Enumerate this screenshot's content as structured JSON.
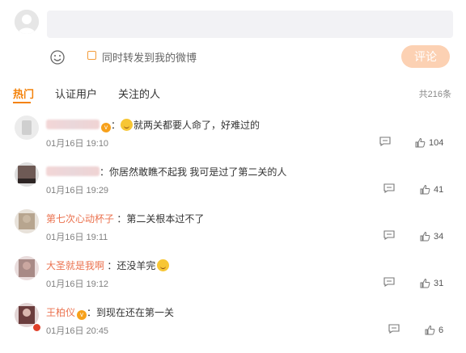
{
  "composer": {
    "repost_label": "同时转发到我的微博",
    "submit_label": "评论"
  },
  "tabs": [
    {
      "label": "热门"
    },
    {
      "label": "认证用户"
    },
    {
      "label": "关注的人"
    }
  ],
  "total_count": "共216条",
  "comments": [
    {
      "username": "",
      "text": "就两关都要人命了，好难过的",
      "time": "01月16日 19:10",
      "likes": "104",
      "avatar_color": "#d8d8d8"
    },
    {
      "username": "",
      "text": "你居然敢瞧不起我 我可是过了第二关的人",
      "time": "01月16日 19:29",
      "likes": "41",
      "avatar_color": "#6e5a55"
    },
    {
      "username": "第七次心动杯子",
      "text": "第二关根本过不了",
      "time": "01月16日 19:11",
      "likes": "34",
      "avatar_color": "#b7a58f"
    },
    {
      "username": "大圣就是我啊",
      "text": "还没羊完",
      "time": "01月16日 19:12",
      "likes": "31",
      "avatar_color": "#a88a86"
    },
    {
      "username": "王柏仪",
      "text": "到现在还在第一关",
      "time": "01月16日 20:45",
      "likes": "6",
      "avatar_color": "#6b3d3d"
    }
  ],
  "colors": {
    "accent": "#f4820a",
    "username": "#eb7350",
    "comment_button": "#fcd1b3"
  }
}
